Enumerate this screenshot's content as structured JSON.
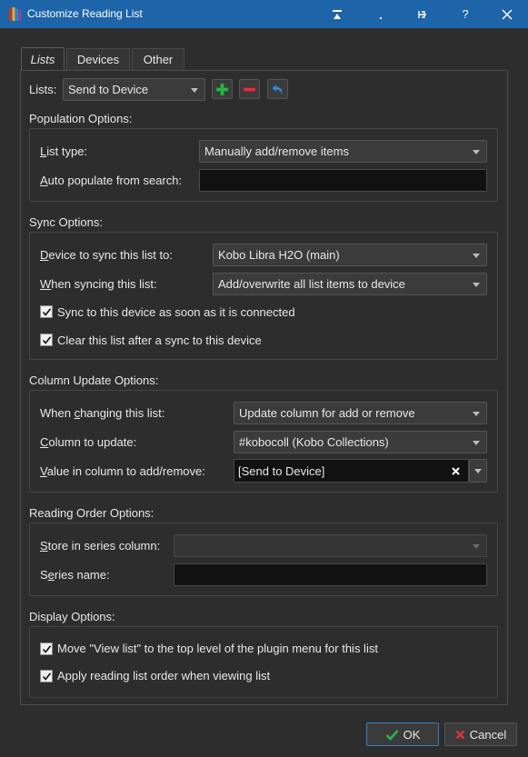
{
  "window": {
    "title": "Customize Reading List",
    "buttons": [
      "restore",
      "minimize",
      "pin",
      "help",
      "close"
    ]
  },
  "tabs": [
    {
      "label": "Lists",
      "active": true
    },
    {
      "label": "Devices",
      "active": false
    },
    {
      "label": "Other",
      "active": false
    }
  ],
  "lists": {
    "label": "Lists:",
    "selected": "Send to Device"
  },
  "population": {
    "heading": "Population Options:",
    "list_type_label": "List type:",
    "list_type_value": "Manually add/remove items",
    "auto_populate_label": "Auto populate from search:",
    "auto_populate_value": ""
  },
  "sync": {
    "heading": "Sync Options:",
    "device_label": "Device to sync this list to:",
    "device_value": "Kobo Libra H2O (main)",
    "when_syncing_label": "When syncing this list:",
    "when_syncing_value": "Add/overwrite all list items to device",
    "sync_connected_label": "Sync to this device as soon as it is connected",
    "sync_connected_checked": true,
    "clear_after_label": "Clear this list after a sync to this device",
    "clear_after_checked": true
  },
  "column_update": {
    "heading": "Column Update Options:",
    "when_changing_label": "When changing this list:",
    "when_changing_value": "Update column for add or remove",
    "column_label": "Column to update:",
    "column_value": "#kobocoll (Kobo Collections)",
    "value_label": "Value in column to add/remove:",
    "value_value": "[Send to Device]"
  },
  "reading_order": {
    "heading": "Reading Order Options:",
    "series_column_label": "Store in series column:",
    "series_column_value": "",
    "series_name_label": "Series name:",
    "series_name_value": ""
  },
  "display": {
    "heading": "Display Options:",
    "move_view_label": "Move \"View list\" to the top level of the plugin menu for this list",
    "move_view_checked": true,
    "apply_order_label": "Apply reading list order when viewing list",
    "apply_order_checked": true
  },
  "footer": {
    "ok_label": "OK",
    "cancel_label": "Cancel"
  },
  "colors": {
    "titlebar": "#1e64a8",
    "background": "#2d2d2d",
    "ok_check": "#2fb34a",
    "cancel_x": "#d9363e",
    "add_green": "#2fb34a",
    "remove_red": "#d9363e",
    "undo_blue": "#3a8fd6"
  }
}
